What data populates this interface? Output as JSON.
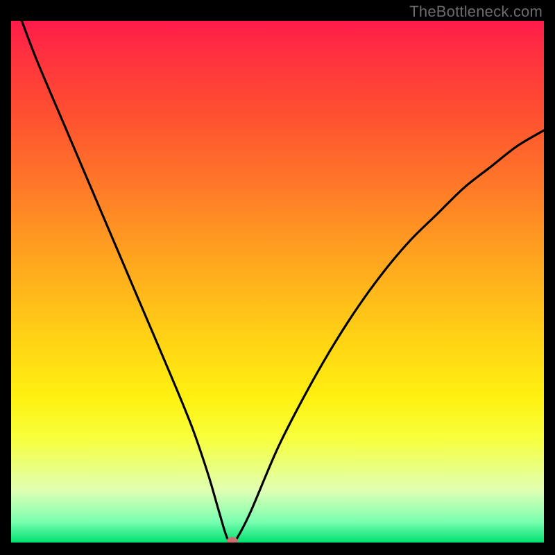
{
  "watermark": "TheBottleneck.com",
  "chart_data": {
    "type": "line",
    "title": "",
    "xlabel": "",
    "ylabel": "",
    "xlim": [
      0,
      100
    ],
    "ylim": [
      0,
      100
    ],
    "grid": false,
    "curve_points": [
      {
        "x": 2,
        "y": 100
      },
      {
        "x": 5,
        "y": 92
      },
      {
        "x": 10,
        "y": 80
      },
      {
        "x": 15,
        "y": 68
      },
      {
        "x": 20,
        "y": 56
      },
      {
        "x": 25,
        "y": 44
      },
      {
        "x": 30,
        "y": 32
      },
      {
        "x": 34,
        "y": 22
      },
      {
        "x": 37,
        "y": 13
      },
      {
        "x": 39,
        "y": 6
      },
      {
        "x": 40.5,
        "y": 1
      },
      {
        "x": 41.5,
        "y": 0
      },
      {
        "x": 42.5,
        "y": 1
      },
      {
        "x": 45,
        "y": 6
      },
      {
        "x": 50,
        "y": 18
      },
      {
        "x": 55,
        "y": 28
      },
      {
        "x": 60,
        "y": 37
      },
      {
        "x": 65,
        "y": 45
      },
      {
        "x": 70,
        "y": 52
      },
      {
        "x": 75,
        "y": 58
      },
      {
        "x": 80,
        "y": 63
      },
      {
        "x": 85,
        "y": 68
      },
      {
        "x": 90,
        "y": 72
      },
      {
        "x": 95,
        "y": 76
      },
      {
        "x": 100,
        "y": 79
      }
    ],
    "marker": {
      "x": 41.5,
      "y": 0
    },
    "gradient_stops": [
      {
        "pos": 0,
        "color": "#ff1a4a"
      },
      {
        "pos": 50,
        "color": "#ffc010"
      },
      {
        "pos": 100,
        "color": "#00e070"
      }
    ]
  }
}
